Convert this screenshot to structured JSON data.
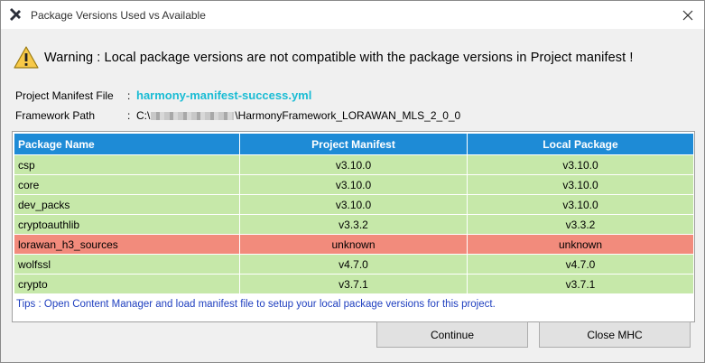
{
  "window": {
    "title": "Package Versions Used vs Available"
  },
  "warning": {
    "text": "Warning : Local package versions are not compatible with the package versions in Project manifest !"
  },
  "info": {
    "manifest_label": "Project Manifest File",
    "manifest_sep": ":",
    "manifest_value": "harmony-manifest-success.yml",
    "framework_label": "Framework Path",
    "framework_sep": ":",
    "framework_prefix": "C:\\",
    "framework_suffix": "\\HarmonyFramework_LORAWAN_MLS_2_0_0"
  },
  "table": {
    "headers": [
      "Package Name",
      "Project Manifest",
      "Local Package"
    ],
    "rows": [
      {
        "name": "csp",
        "manifest": "v3.10.0",
        "local": "v3.10.0",
        "status": "ok"
      },
      {
        "name": "core",
        "manifest": "v3.10.0",
        "local": "v3.10.0",
        "status": "ok"
      },
      {
        "name": "dev_packs",
        "manifest": "v3.10.0",
        "local": "v3.10.0",
        "status": "ok"
      },
      {
        "name": "cryptoauthlib",
        "manifest": "v3.3.2",
        "local": "v3.3.2",
        "status": "ok"
      },
      {
        "name": "lorawan_h3_sources",
        "manifest": "unknown",
        "local": "unknown",
        "status": "mismatch"
      },
      {
        "name": "wolfssl",
        "manifest": "v4.7.0",
        "local": "v4.7.0",
        "status": "ok"
      },
      {
        "name": "crypto",
        "manifest": "v3.7.1",
        "local": "v3.7.1",
        "status": "ok"
      }
    ]
  },
  "tips": {
    "text": "Tips : Open Content Manager and load manifest file to setup your local package versions for this project."
  },
  "buttons": {
    "continue": "Continue",
    "close": "Close MHC"
  },
  "colors": {
    "header_bg": "#1e8bd6",
    "row_ok": "#c6e8a9",
    "row_mismatch": "#f28b7c",
    "manifest_link": "#1abcd4",
    "tips_text": "#1f3fbf"
  }
}
